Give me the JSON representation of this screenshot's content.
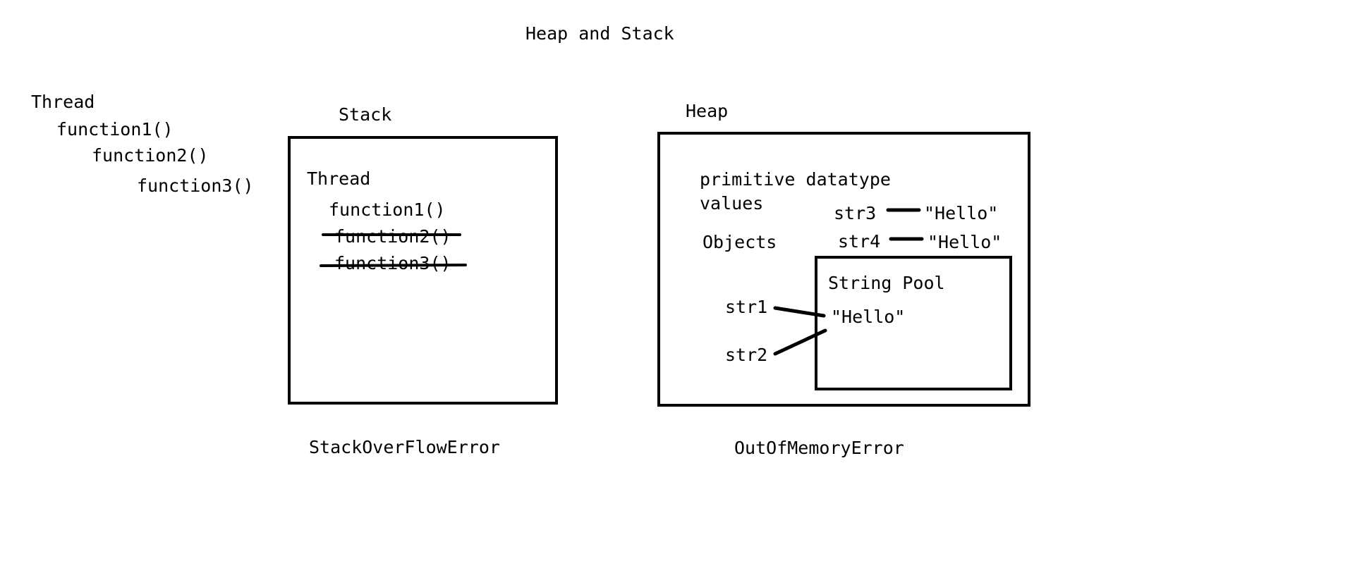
{
  "title": "Heap and Stack",
  "left": {
    "thread": "Thread",
    "functions": [
      "function1()",
      "function2()",
      "function3()"
    ]
  },
  "stack": {
    "label": "Stack",
    "thread": "Thread",
    "functions": [
      "function1()",
      "function2()",
      "function3()"
    ],
    "struck": [
      "function2()",
      "function3()"
    ],
    "error": "StackOverFlowError"
  },
  "heap": {
    "label": "Heap",
    "primitive_line1": "primitive datatype",
    "primitive_line2": "values",
    "objects": "Objects",
    "str3": "str3",
    "str3_value": "\"Hello\"",
    "str4": "str4",
    "str4_value": "\"Hello\"",
    "string_pool": {
      "label": "String Pool",
      "value": "\"Hello\""
    },
    "str1": "str1",
    "str2": "str2",
    "error": "OutOfMemoryError"
  }
}
